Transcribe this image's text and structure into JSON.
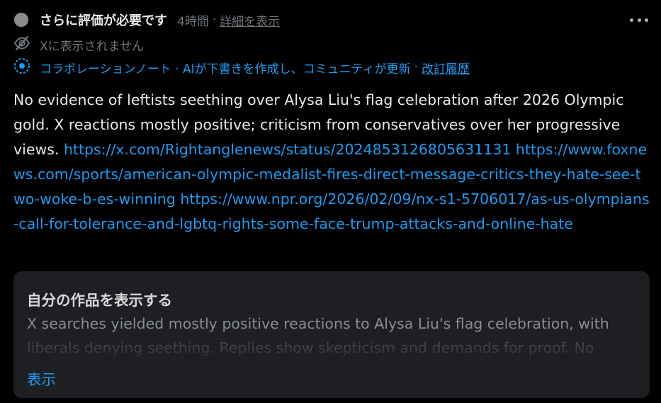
{
  "header": {
    "status_title": "さらに評価が必要です",
    "time": "4時間",
    "separator": "·",
    "details_link": "詳細を表示"
  },
  "visibility": {
    "text": "Xに表示されません",
    "icon": "eye-slash-icon"
  },
  "attribution": {
    "icon": "collab-note-icon",
    "text": "コラボレーションノート · AIが下書きを作成し、コミュニティが更新",
    "separator": "·",
    "history_link": "改訂履歴"
  },
  "note": {
    "text": "No evidence of leftists seething over Alysa Liu's flag celebration after 2026 Olympic gold. X reactions mostly positive; criticism from conservatives over her progressive views.",
    "links": [
      "https://x.com/Rightanglenews/status/2024853126805631131",
      "https://www.foxnews.com/sports/american-olympic-medalist-fires-direct-message-critics-they-hate-see-two-woke-b-es-winning",
      "https://www.npr.org/2026/02/09/nx-s1-5706017/as-us-olympians-call-for-tolerance-and-lgbtq-rights-some-face-trump-attacks-and-online-hate"
    ]
  },
  "card": {
    "title": "自分の作品を表示する",
    "body": "X searches yielded mostly positive reactions to Alysa Liu's flag celebration, with liberals denying seething. Replies show skepticism and demands for proof. No",
    "show_label": "表示"
  },
  "colors": {
    "background": "#000000",
    "link": "#1d9bf0",
    "muted": "#71767b",
    "card": "#1e1f22"
  }
}
